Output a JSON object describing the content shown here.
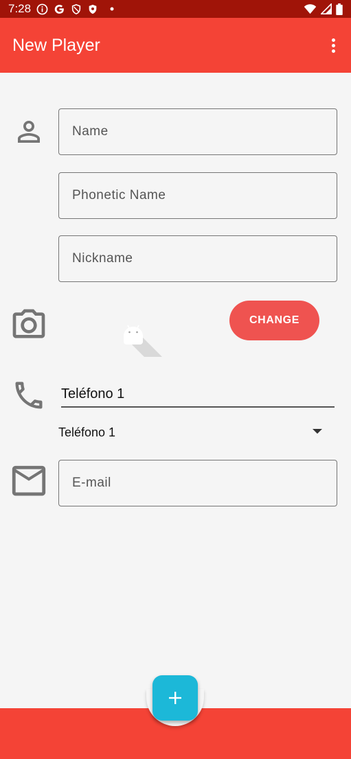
{
  "status_bar": {
    "time": "7:28",
    "icons": [
      "info-icon",
      "google-icon",
      "shield-icon",
      "security-icon",
      "dot-icon",
      "wifi-icon",
      "signal-icon",
      "battery-icon"
    ]
  },
  "app_bar": {
    "title": "New Player",
    "menu_icon": "more-vert-icon"
  },
  "form": {
    "name_placeholder": "Name",
    "phonetic_name_placeholder": "Phonetic Name",
    "nickname_placeholder": "Nickname",
    "photo_button_label": "CHANGE",
    "phone_value": "Teléfono 1",
    "phone_type_selected": "Teléfono 1",
    "email_placeholder": "E-mail"
  },
  "fab": {
    "icon": "add-icon"
  },
  "colors": {
    "status_bar": "#a01408",
    "primary": "#f44336",
    "accent_button": "#ef5350",
    "fab": "#1cb8d8",
    "background": "#f5f5f5"
  }
}
